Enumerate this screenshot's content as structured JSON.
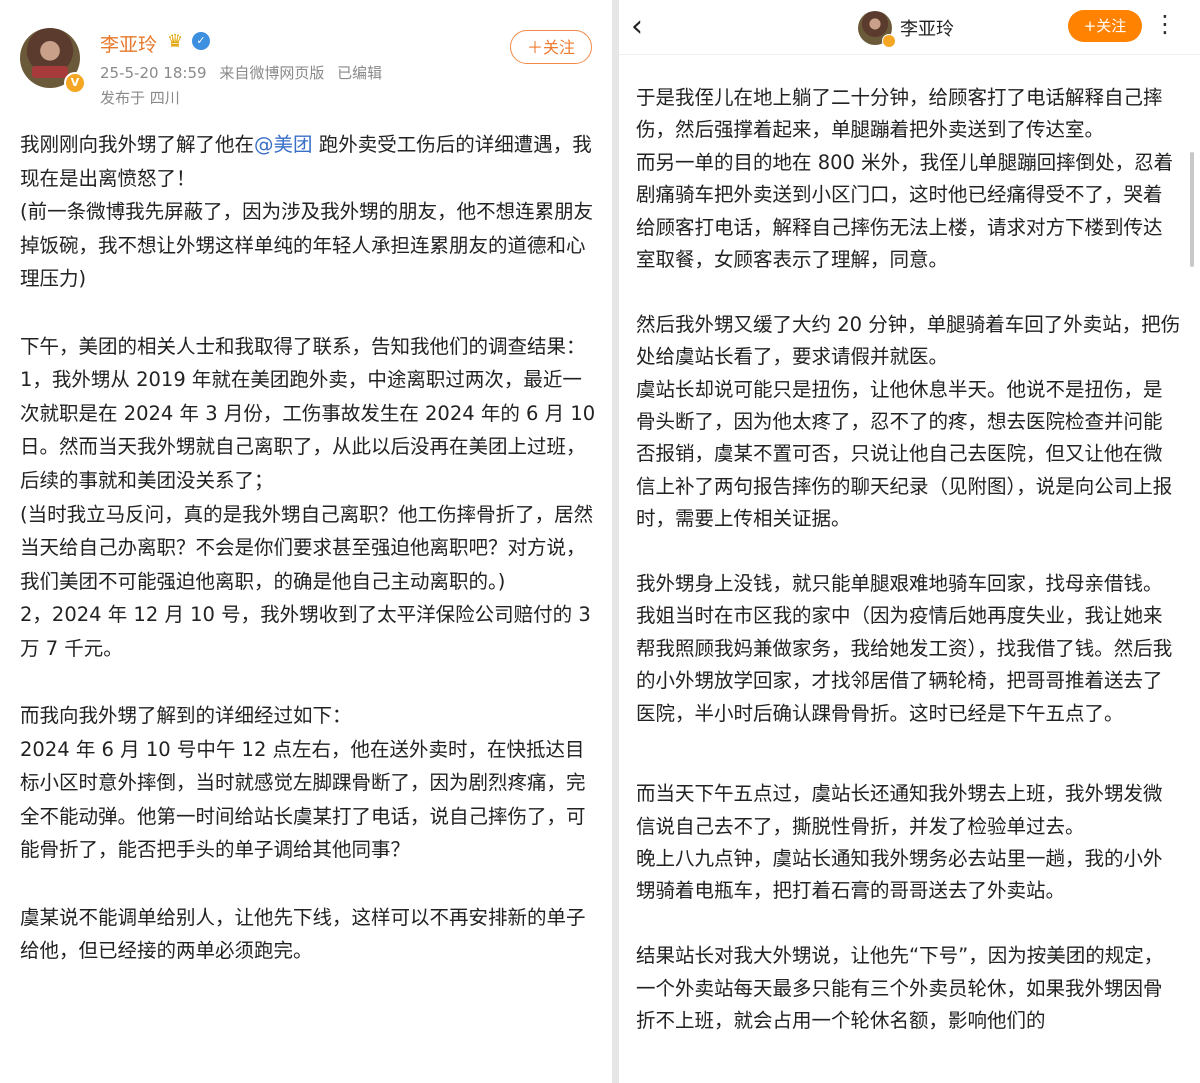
{
  "left": {
    "user": {
      "name": "李亚玲",
      "crown_icon": "crown-icon",
      "verify_icon": "verify-icon",
      "avatar_badge": "V"
    },
    "meta": {
      "time": "25-5-20 18:59",
      "source": "来自微博网页版",
      "edited": "已编辑",
      "location": "发布于 四川"
    },
    "follow_label": "＋关注",
    "post": {
      "p1_a": "我刚刚向我外甥了解了他在",
      "p1_mention": "@美团",
      "p1_b": " 跑外卖受工伤后的详细遭遇，我现在是出离愤怒了！",
      "p2": "(前一条微博我先屏蔽了，因为涉及我外甥的朋友，他不想连累朋友掉饭碗，我不想让外甥这样单纯的年轻人承担连累朋友的道德和心理压力)",
      "p3": "下午，美团的相关人士和我取得了联系，告知我他们的调查结果：",
      "p4": "1，我外甥从 2019 年就在美团跑外卖，中途离职过两次，最近一次就职是在 2024 年 3 月份，工伤事故发生在 2024 年的 6 月 10 日。然而当天我外甥就自己离职了，从此以后没再在美团上过班，后续的事就和美团没关系了；",
      "p5": "(当时我立马反问，真的是我外甥自己离职？他工伤摔骨折了，居然当天给自己办离职？不会是你们要求甚至强迫他离职吧？对方说，我们美团不可能强迫他离职，的确是他自己主动离职的。)",
      "p6": "2，2024 年 12 月 10 号，我外甥收到了太平洋保险公司赔付的 3 万 7 千元。",
      "p7": "而我向我外甥了解到的详细经过如下：",
      "p8": "2024 年 6 月 10 号中午 12 点左右，他在送外卖时，在快抵达目标小区时意外摔倒，当时就感觉左脚踝骨断了，因为剧烈疼痛，完全不能动弹。他第一时间给站长虞某打了电话，说自己摔伤了，可能骨折了，能否把手头的单子调给其他同事？",
      "p9": "虞某说不能调单给别人，让他先下线，这样可以不再安排新的单子给他，但已经接的两单必须跑完。"
    }
  },
  "right": {
    "header": {
      "back_icon": "‹",
      "name": "李亚玲",
      "follow_label": "+关注",
      "more_icon": "⋮"
    },
    "post": {
      "p1": "于是我侄儿在地上躺了二十分钟，给顾客打了电话解释自己摔伤，然后强撑着起来，单腿蹦着把外卖送到了传达室。",
      "p2": "而另一单的目的地在 800 米外，我侄儿单腿蹦回摔倒处，忍着剧痛骑车把外卖送到小区门口，这时他已经痛得受不了，哭着给顾客打电话，解释自己摔伤无法上楼，请求对方下楼到传达室取餐，女顾客表示了理解，同意。",
      "p3": "然后我外甥又缓了大约 20 分钟，单腿骑着车回了外卖站，把伤处给虞站长看了，要求请假并就医。",
      "p4": "虞站长却说可能只是扭伤，让他休息半天。他说不是扭伤，是骨头断了，因为他太疼了，忍不了的疼，想去医院检查并问能否报销，虞某不置可否，只说让他自己去医院，但又让他在微信上补了两句报告摔伤的聊天纪录（见附图），说是向公司上报时，需要上传相关证据。",
      "p5": "我外甥身上没钱，就只能单腿艰难地骑车回家，找母亲借钱。",
      "p6": "我姐当时在市区我的家中（因为疫情后她再度失业，我让她来帮我照顾我妈兼做家务，我给她发工资），找我借了钱。然后我的小外甥放学回家，才找邻居借了辆轮椅，把哥哥推着送去了医院，半小时后确认踝骨骨折。这时已经是下午五点了。",
      "p7": "而当天下午五点过，虞站长还通知我外甥去上班，我外甥发微信说自己去不了，撕脱性骨折，并发了检验单过去。",
      "p8": "晚上八九点钟，虞站长通知我外甥务必去站里一趟，我的小外甥骑着电瓶车，把打着石膏的哥哥送去了外卖站。",
      "p9": "结果站长对我大外甥说，让他先“下号”，因为按美团的规定，一个外卖站每天最多只能有三个外卖员轮休，如果我外甥因骨折不上班，就会占用一个轮休名额，影响他们的"
    }
  }
}
